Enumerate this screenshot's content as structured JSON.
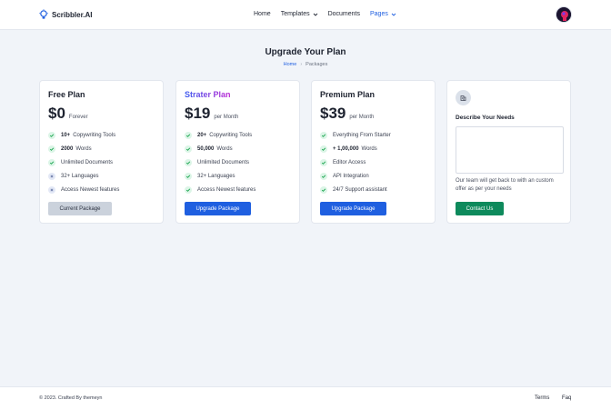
{
  "brand": {
    "name": "Scribbler.AI",
    "logo_icon": "lightbulb-icon"
  },
  "nav": {
    "items": [
      {
        "label": "Home"
      },
      {
        "label": "Templates"
      },
      {
        "label": "Documents"
      },
      {
        "label": "Pages"
      }
    ],
    "active": "Pages"
  },
  "page": {
    "title": "Upgrade Your Plan",
    "breadcrumb": {
      "home": "Home",
      "separator": "›",
      "current": "Packages"
    }
  },
  "plans": [
    {
      "title": "Free Plan",
      "price": "$0",
      "period": "Forever",
      "features": [
        {
          "bold": "10+",
          "text": "Copywriting Tools",
          "included": true
        },
        {
          "bold": "2000",
          "text": "Words",
          "included": true
        },
        {
          "bold": "",
          "text": "Unlimited Documents",
          "included": true
        },
        {
          "bold": "",
          "text": "32+ Languages",
          "included": false
        },
        {
          "bold": "",
          "text": "Access Newest features",
          "included": false
        }
      ],
      "button": "Current Package"
    },
    {
      "title": "Strater Plan",
      "price": "$19",
      "period": "per Month",
      "features": [
        {
          "bold": "20+",
          "text": "Copywriting Tools",
          "included": true
        },
        {
          "bold": "50,000",
          "text": "Words",
          "included": true
        },
        {
          "bold": "",
          "text": "Unlimited Documents",
          "included": true
        },
        {
          "bold": "",
          "text": "32+ Languages",
          "included": true
        },
        {
          "bold": "",
          "text": "Access Newest features",
          "included": true
        }
      ],
      "button": "Upgrade Package"
    },
    {
      "title": "Premium Plan",
      "price": "$39",
      "period": "per Month",
      "features": [
        {
          "bold": "",
          "text": "Everything From Starter",
          "included": true
        },
        {
          "bold": "+ 1,00,000",
          "text": "Words",
          "included": true
        },
        {
          "bold": "",
          "text": "Editor Access",
          "included": true
        },
        {
          "bold": "",
          "text": "API Integration",
          "included": true
        },
        {
          "bold": "",
          "text": "24/7 Support assistant",
          "included": true
        }
      ],
      "button": "Upgrade Package"
    }
  ],
  "custom": {
    "icon": "building-icon",
    "label": "Describe Your Needs",
    "textarea_value": "",
    "note": "Our team will get back to with an custom offer as per your needs",
    "button": "Contact Us"
  },
  "footer": {
    "copyright": "© 2023. Crafted By themeyn",
    "links": [
      "Terms",
      "Faq"
    ]
  },
  "colors": {
    "accent": "#1f5fe0",
    "success": "#0e8a5c",
    "background": "#f1f4f9",
    "gradient_start": "#3b5cf0",
    "gradient_end": "#c026d3"
  }
}
